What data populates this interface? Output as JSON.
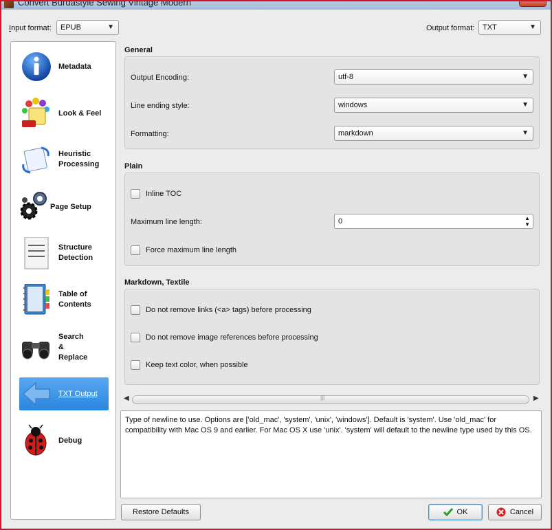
{
  "window": {
    "title": "Convert Burdastyle Sewing Vintage Modern"
  },
  "topbar": {
    "input_format_label": "Input format:",
    "input_format_value": "EPUB",
    "output_format_label": "Output format:",
    "output_format_value": "TXT"
  },
  "sidebar": {
    "items": [
      {
        "label": "Metadata",
        "icon": "info-icon"
      },
      {
        "label": "Look & Feel",
        "icon": "paint-bucket-icon"
      },
      {
        "label_l1": "Heuristic",
        "label_l2": "Processing",
        "icon": "heuristic-icon"
      },
      {
        "label": "Page Setup",
        "icon": "gears-icon"
      },
      {
        "label_l1": "Structure",
        "label_l2": "Detection",
        "icon": "document-lines-icon"
      },
      {
        "label_l1": "Table of",
        "label_l2": "Contents",
        "icon": "notebook-icon"
      },
      {
        "label_l1": "Search",
        "label_l2": "&",
        "label_l3": "Replace",
        "icon": "binoculars-icon"
      },
      {
        "label": "TXT Output",
        "icon": "arrow-left-icon",
        "active": true
      },
      {
        "label": "Debug",
        "icon": "ladybug-icon"
      }
    ]
  },
  "general": {
    "title": "General",
    "output_encoding_label": "Output Encoding:",
    "output_encoding_value": "utf-8",
    "line_ending_label": "Line ending style:",
    "line_ending_value": "windows",
    "formatting_label": "Formatting:",
    "formatting_value": "markdown"
  },
  "plain": {
    "title": "Plain",
    "inline_toc_label": "Inline TOC",
    "max_line_length_label": "Maximum line length:",
    "max_line_length_value": "0",
    "force_max_label": "Force maximum line length"
  },
  "markdown": {
    "title": "Markdown, Textile",
    "keep_links_label": "Do not remove links (<a> tags) before processing",
    "keep_images_label": "Do not remove image references before processing",
    "keep_color_label": "Keep text color, when possible"
  },
  "help": {
    "text": "Type of newline to use. Options are ['old_mac', 'system', 'unix', 'windows']. Default is 'system'. Use 'old_mac' for compatibility with Mac OS 9 and earlier. For Mac OS X use 'unix'. 'system' will default to the newline type used by this OS."
  },
  "buttons": {
    "restore_defaults": "Restore Defaults",
    "ok": "OK",
    "cancel": "Cancel"
  },
  "colors": {
    "accent": "#2a86e0",
    "window_border": "#d4132a"
  }
}
